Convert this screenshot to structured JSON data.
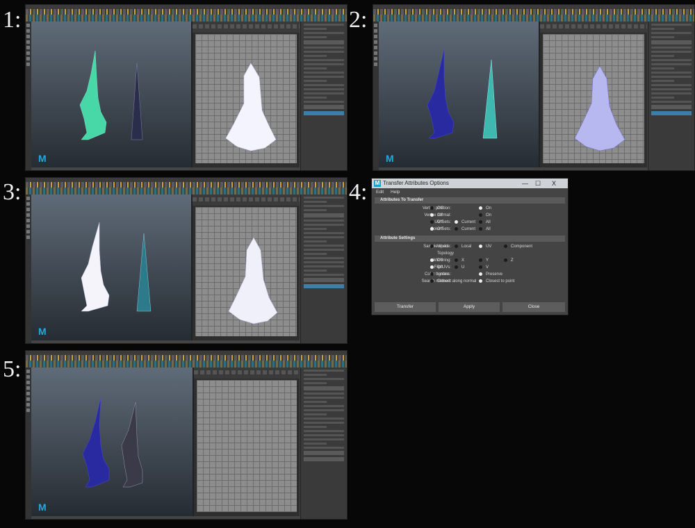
{
  "step_labels": {
    "s1": "1:",
    "s2": "2:",
    "s3": "3:",
    "s4": "4:",
    "s5": "5:"
  },
  "app_logo": "M",
  "dialog": {
    "title": "Transfer Attributes Options",
    "window_buttons": {
      "minimize": "—",
      "maximize": "☐",
      "close": "X"
    },
    "menu": {
      "edit": "Edit",
      "help": "Help"
    },
    "sections": {
      "transfer": "Attributes To Transfer",
      "settings": "Attribute Settings"
    },
    "fields": {
      "vertex_position": {
        "label": "Vertex position:",
        "options": [
          "Off",
          "On"
        ],
        "selected": "On"
      },
      "vertex_normal": {
        "label": "Vertex normal:",
        "options": [
          "Off",
          "On"
        ],
        "selected": "Off"
      },
      "uv_sets": {
        "label": "UV Sets:",
        "options": [
          "Off",
          "Current",
          "All"
        ],
        "selected": "Current"
      },
      "color_sets": {
        "label": "Color Sets:",
        "options": [
          "Off",
          "Current",
          "All"
        ],
        "selected": "Off"
      },
      "sample_space": {
        "label": "Sample space:",
        "options": [
          "World",
          "Local",
          "UV",
          "Component",
          "Topology"
        ],
        "selected": "UV"
      },
      "mirroring": {
        "label": "Mirroring:",
        "options": [
          "Off",
          "X",
          "Y",
          "Z"
        ],
        "selected": "Off"
      },
      "flip_uvs": {
        "label": "Flip UVs:",
        "options": [
          "Off",
          "U",
          "V"
        ],
        "selected": "Off"
      },
      "color_borders": {
        "label": "Color borders:",
        "options": [
          "Ignore",
          "Preserve"
        ],
        "selected": "Preserve"
      },
      "search_method": {
        "label": "Search method:",
        "options": [
          "Closest along normal",
          "Closest to point"
        ],
        "selected": "Closest to point"
      }
    },
    "buttons": {
      "transfer": "Transfer",
      "apply": "Apply",
      "close": "Close"
    }
  },
  "colors": {
    "accent_blue": "#2aa6d6",
    "mesh_green": "#48d8a8",
    "mesh_blue": "#2a2aa0",
    "selection_blue": "#3f7fa6"
  }
}
